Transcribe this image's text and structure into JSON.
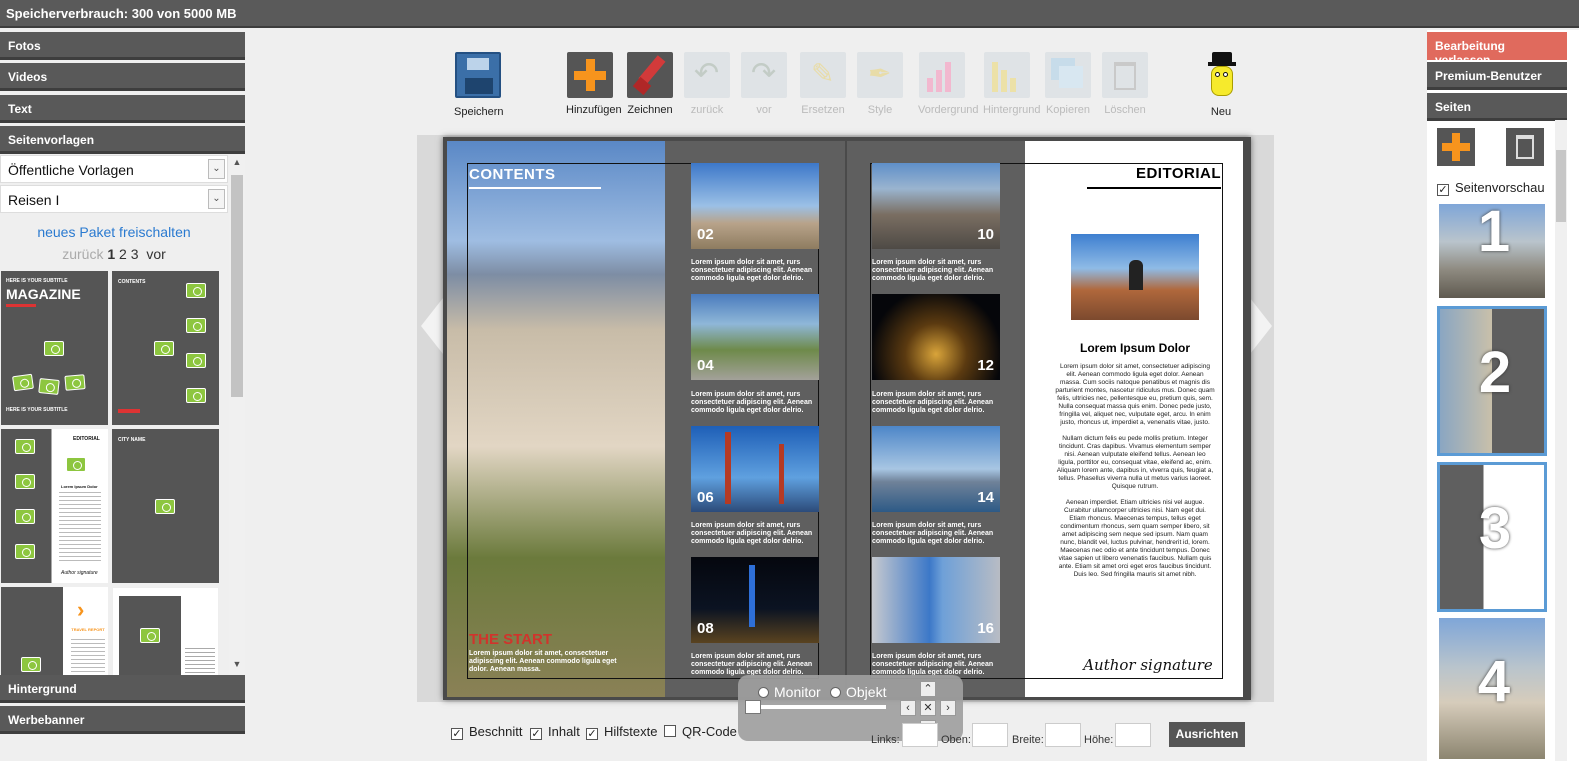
{
  "topbar": {
    "storage": "Speicherverbrauch: 300 von 5000 MB"
  },
  "left": {
    "sections": {
      "fotos": "Fotos",
      "videos": "Videos",
      "text": "Text",
      "seitenvorlagen": "Seitenvorlagen",
      "hintergrund": "Hintergrund",
      "werbebanner": "Werbebanner"
    },
    "select_category": "Öffentliche Vorlagen",
    "select_package": "Reisen I",
    "paket_link": "neues Paket freischalten",
    "pager": {
      "prev": "zurück",
      "p1": "1",
      "p2": "2",
      "p3": "3",
      "next": "vor"
    },
    "templates": {
      "t1_subtitle": "HERE IS YOUR SUBTITLE",
      "t1_title": "MAGAZINE",
      "t1_bottom": "HERE IS YOUR SUBTITLE",
      "t2_title": "CONTENTS",
      "t3_title": "EDITORIAL",
      "t3_heading": "Lorem Ipsum Dolor",
      "t3_signature": "Author signature",
      "t4_title": "CITY NAME",
      "t5_title": "TRAVEL REPORT"
    }
  },
  "toolbar": {
    "speichern": "Speichern",
    "hinzufuegen": "Hinzufügen",
    "zeichnen": "Zeichnen",
    "zurueck": "zurück",
    "vor": "vor",
    "ersetzen": "Ersetzen",
    "style": "Style",
    "vordergrund": "Vordergrund",
    "hintergrund": "Hintergrund",
    "kopieren": "Kopieren",
    "loeschen": "Löschen",
    "neu": "Neu"
  },
  "spread": {
    "left_title": "CONTENTS",
    "left_start": "THE START",
    "left_start_text": "Lorem ipsum dolor sit amet, consectetuer adipiscing elit. Aenean commodo ligula eget dolor. Aenean massa.",
    "lorem_short": "Lorem ipsum dolor sit amet, rurs consectetuer adipiscing elit. Aenean commodo ligula eget dolor delrio.",
    "numbers": [
      "02",
      "04",
      "06",
      "08",
      "10",
      "12",
      "14",
      "16"
    ],
    "right_title": "EDITORIAL",
    "right_heading": "Lorem Ipsum Dolor",
    "right_body1": "Lorem ipsum dolor sit amet, consectetuer adipiscing elit. Aenean commodo ligula eget dolor. Aenean massa. Cum sociis natoque penatibus et magnis dis parturient montes, nascetur ridiculus mus. Donec quam felis, ultricies nec, pellentesque eu, pretium quis, sem. Nulla consequat massa quis enim. Donec pede justo, fringilla vel, aliquet nec, vulputate eget, arcu. In enim justo, rhoncus ut, imperdiet a, venenatis vitae, justo.",
    "right_body2": "Nullam dictum felis eu pede mollis pretium. Integer tincidunt. Cras dapibus. Vivamus elementum semper nisi. Aenean vulputate eleifend tellus. Aenean leo ligula, porttitor eu, consequat vitae, eleifend ac, enim. Aliquam lorem ante, dapibus in, viverra quis, feugiat a, tellus. Phasellus viverra nulla ut metus varius laoreet. Quisque rutrum.",
    "right_body3": "Aenean imperdiet. Etiam ultricies nisi vel augue. Curabitur ullamcorper ultricies nisi. Nam eget dui. Etiam rhoncus. Maecenas tempus, tellus eget condimentum rhoncus, sem quam semper libero, sit amet adipiscing sem neque sed ipsum. Nam quam nunc, blandit vel, luctus pulvinar, hendrerit id, lorem. Maecenas nec odio et ante tincidunt tempus. Donec vitae sapien ut libero venenatis faucibus. Nullam quis ante. Etiam sit amet orci eget eros faucibus tincidunt. Duis leo. Sed fringilla mauris sit amet nibh.",
    "right_signature": "Author signature"
  },
  "right": {
    "exit": "Bearbeitung verlassen",
    "premium": "Premium-Benutzer",
    "seiten": "Seiten",
    "preview_label": "Seitenvorschau",
    "page_numbers": [
      "1",
      "2",
      "3",
      "4"
    ]
  },
  "bottom": {
    "beschnitt": "Beschnitt",
    "inhalt": "Inhalt",
    "hilfstexte": "Hilfstexte",
    "qrcode": "QR-Code",
    "links": "Links:",
    "oben": "Oben:",
    "breite": "Breite:",
    "hoehe": "Höhe:",
    "ausrichten": "Ausrichten"
  },
  "overlay": {
    "monitor": "Monitor",
    "objekt": "Objekt"
  },
  "colors": {
    "accent_orange": "#f7941d",
    "exit_red": "#e06a5d",
    "camera_green": "#8dc63f",
    "link_blue": "#2a7ad0"
  }
}
